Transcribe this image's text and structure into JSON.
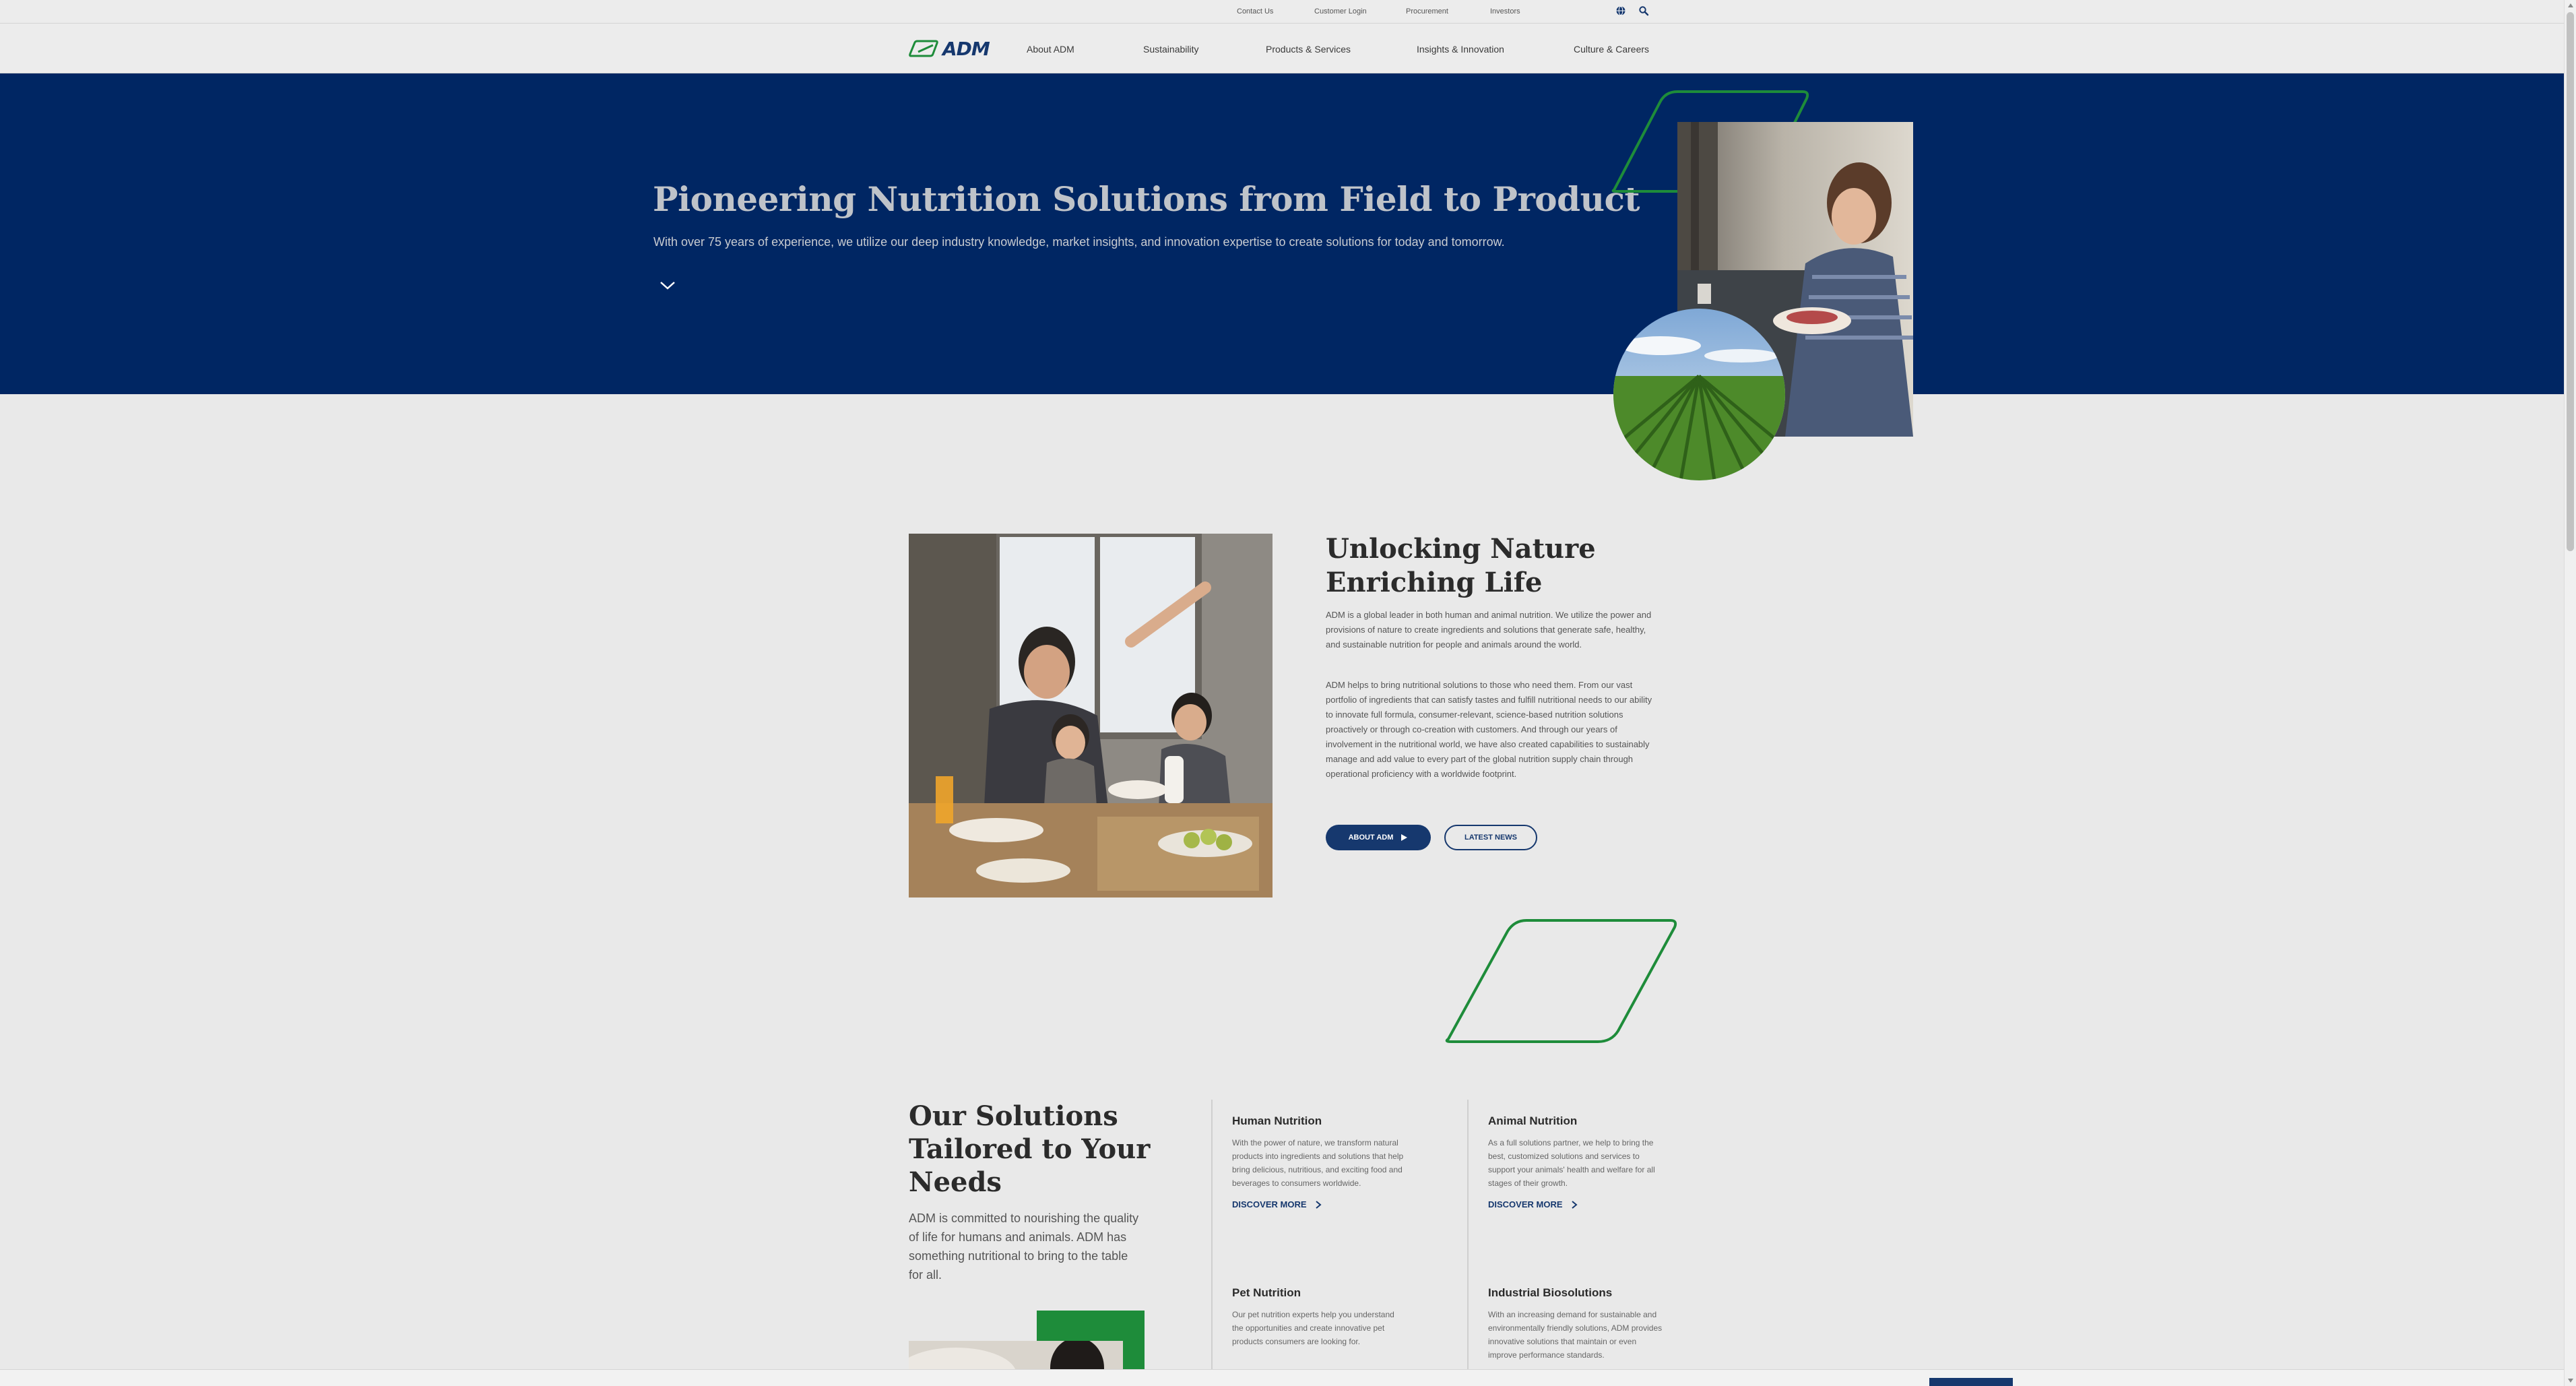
{
  "utility_nav": {
    "links": [
      "Contact Us",
      "Customer Login",
      "Procurement",
      "Investors"
    ],
    "globe_icon": "globe-icon",
    "search_icon": "search-icon"
  },
  "main_nav": {
    "logo_text": "ADM",
    "items": [
      "About ADM",
      "Sustainability",
      "Products & Services",
      "Insights & Innovation",
      "Culture & Careers"
    ]
  },
  "hero": {
    "title": "Pioneering Nutrition Solutions from Field to Product",
    "subtitle": "With over 75 years of experience, we utilize our deep industry knowledge, market insights, and innovation expertise to create solutions for today and tomorrow.",
    "scroll_icon": "chevron-down-icon"
  },
  "about": {
    "title_line1": "Unlocking Nature",
    "title_line2": "Enriching Life",
    "paragraph1": "ADM is a global leader in both human and animal nutrition. We utilize the power and provisions of nature to create ingredients and solutions that generate safe, healthy, and sustainable nutrition for people and animals around the world.",
    "paragraph2": "ADM helps to bring nutritional solutions to those who need them. From our vast portfolio of ingredients that can satisfy tastes and fulfill nutritional needs to our ability to innovate full formula, consumer-relevant, science-based nutrition solutions proactively or through co-creation with customers. And through our years of involvement in the nutritional world, we have also created capabilities to sustainably manage and add value to every part of the global nutrition supply chain through operational proficiency with a worldwide footprint.",
    "primary_button": "ABOUT ADM",
    "secondary_button": "LATEST NEWS"
  },
  "solutions": {
    "title_line1": "Our Solutions",
    "title_line2": "Tailored to Your",
    "title_line3": "Needs",
    "intro": "ADM is committed to nourishing the quality of life for humans and animals. ADM has something nutritional to bring to the table for all.",
    "cards": [
      {
        "title": "Human Nutrition",
        "description": "With the power of nature, we transform natural products into ingredients and solutions that help bring delicious, nutritious, and exciting food and beverages to consumers worldwide.",
        "link": "DISCOVER MORE"
      },
      {
        "title": "Animal Nutrition",
        "description": "As a full solutions partner, we help to bring the best, customized solutions and services to support your animals' health and welfare for all stages of their growth.",
        "link": "DISCOVER MORE"
      },
      {
        "title": "Pet Nutrition",
        "description": "Our pet nutrition experts help you understand the opportunities and create innovative pet products consumers are looking for."
      },
      {
        "title": "Industrial Biosolutions",
        "description": "With an increasing demand for sustainable and environmentally friendly solutions, ADM provides innovative solutions that maintain or even improve performance standards."
      }
    ]
  },
  "colors": {
    "navy": "#002663",
    "brand_blue": "#16386e",
    "green": "#1e8c3a",
    "page_bg": "#e9e9e9"
  }
}
